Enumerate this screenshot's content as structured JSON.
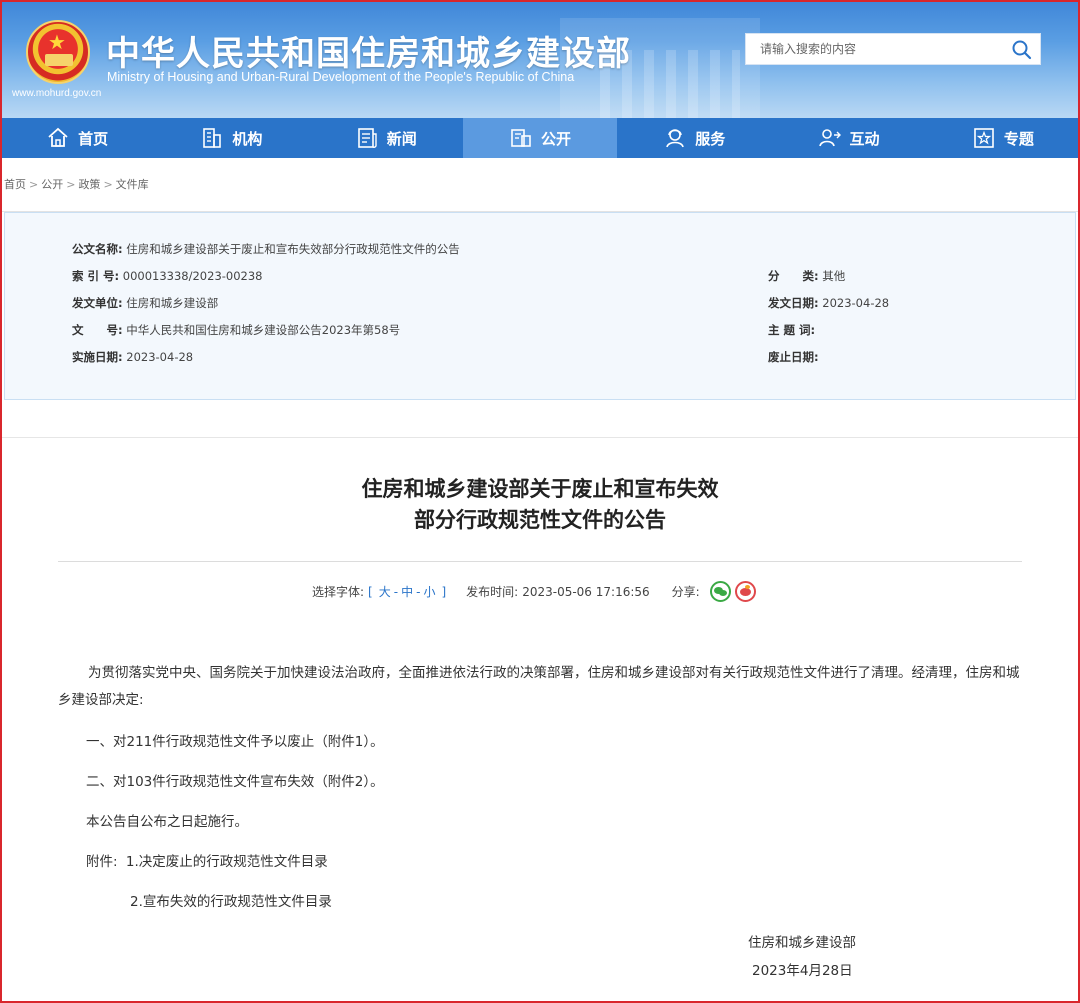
{
  "header": {
    "site_title": "中华人民共和国住房和城乡建设部",
    "site_subtitle": "Ministry of Housing and Urban-Rural Development of the People's Republic of China",
    "site_url": "www.mohurd.gov.cn",
    "emblem_icon": "national-emblem-icon",
    "search_placeholder": "请输入搜索的内容",
    "search_icon": "search-icon"
  },
  "nav": {
    "items": [
      {
        "label": "首页",
        "icon": "home-icon"
      },
      {
        "label": "机构",
        "icon": "building-icon"
      },
      {
        "label": "新闻",
        "icon": "news-icon"
      },
      {
        "label": "公开",
        "icon": "document-icon",
        "active": true
      },
      {
        "label": "服务",
        "icon": "service-icon"
      },
      {
        "label": "互动",
        "icon": "interaction-icon"
      },
      {
        "label": "专题",
        "icon": "star-icon"
      }
    ]
  },
  "breadcrumb": {
    "items": [
      "首页",
      "公开",
      "政策",
      "文件库"
    ],
    "separator": ">"
  },
  "meta": {
    "doc_name_label": "公文名称:",
    "doc_name": "住房和城乡建设部关于废止和宣布失效部分行政规范性文件的公告",
    "index_label": "索 引 号:",
    "index": "000013338/2023-00238",
    "category_label": "分　　类:",
    "category": "其他",
    "issuer_label": "发文单位:",
    "issuer": "住房和城乡建设部",
    "issue_date_label": "发文日期:",
    "issue_date": "2023-04-28",
    "doc_no_label": "文　　号:",
    "doc_no": "中华人民共和国住房和城乡建设部公告2023年第58号",
    "keywords_label": "主 题 词:",
    "keywords": "",
    "effective_label": "实施日期:",
    "effective": "2023-04-28",
    "repeal_label": "废止日期:",
    "repeal": ""
  },
  "article": {
    "title_line1": "住房和城乡建设部关于废止和宣布失效",
    "title_line2": "部分行政规范性文件的公告",
    "font_select_label": "选择字体:",
    "font_bracket_open": "[",
    "font_large": "大",
    "font_mid": "中",
    "font_small": "小",
    "font_dash": "-",
    "font_bracket_close": "]",
    "publish_label": "发布时间:",
    "publish_time": "2023-05-06 17:16:56",
    "share_label": "分享:",
    "paragraphs": {
      "p1": "为贯彻落实党中央、国务院关于加快建设法治政府，全面推进依法行政的决策部署，住房和城乡建设部对有关行政规范性文件进行了清理。经清理，住房和城乡建设部决定:",
      "p2": "一、对211件行政规范性文件予以废止（附件1）。",
      "p3": "二、对103件行政规范性文件宣布失效（附件2）。",
      "p4": "本公告自公布之日起施行。",
      "attachments_label": "附件:",
      "attachment1": "1.决定废止的行政规范性文件目录",
      "attachment2": "2.宣布失效的行政规范性文件目录"
    },
    "signature": "住房和城乡建设部",
    "sign_date": "2023年4月28日"
  },
  "colors": {
    "nav_bg": "#2a74c9",
    "nav_active": "#5b9ae0",
    "meta_bg": "#f3f8fd",
    "frame": "#d9262c",
    "link": "#2a74c9"
  }
}
